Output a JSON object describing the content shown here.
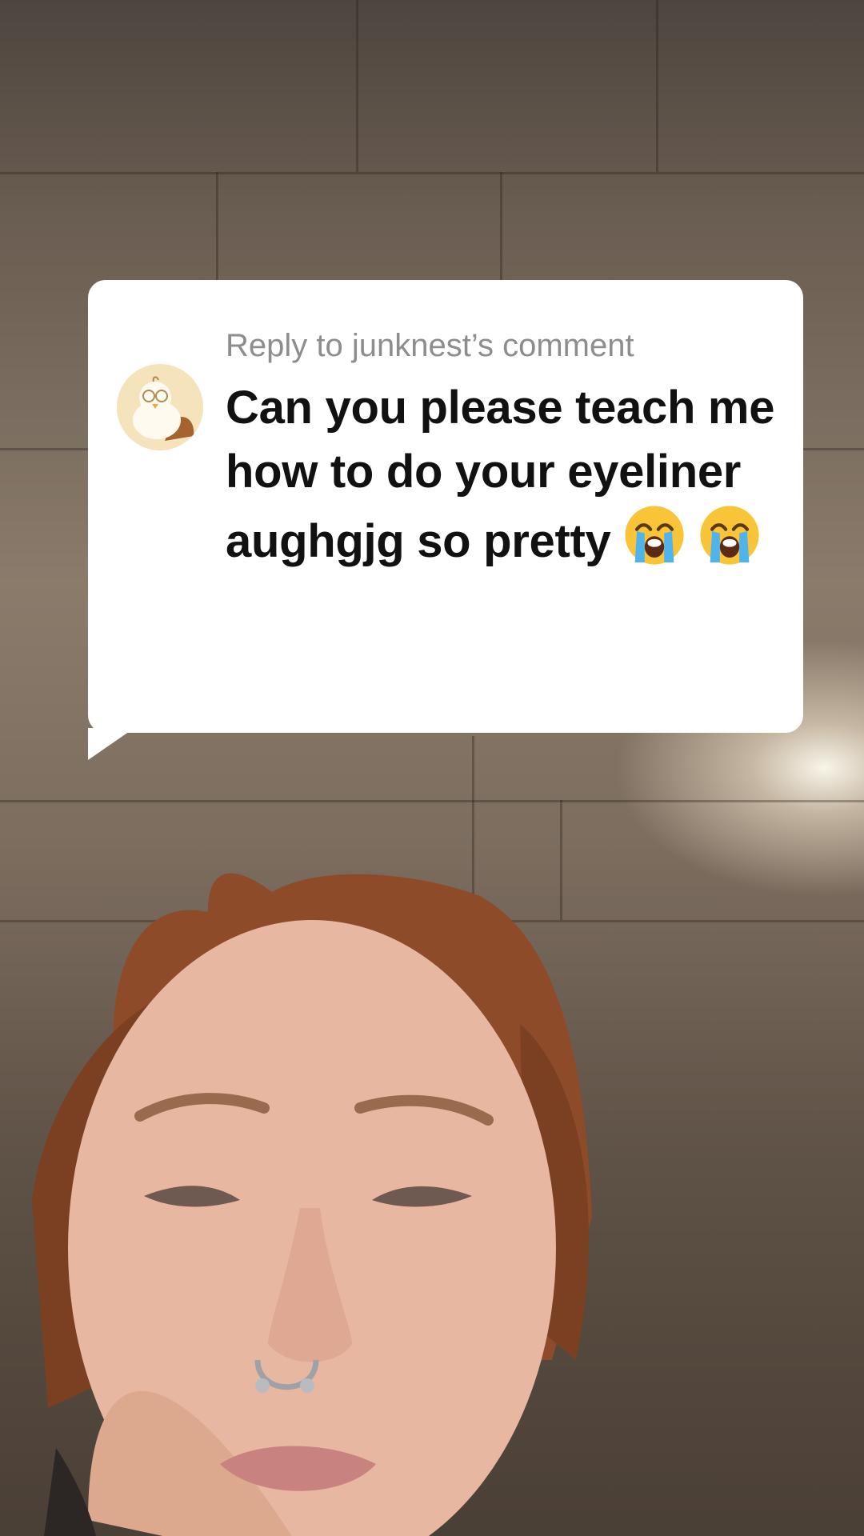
{
  "comment_card": {
    "reply_label": "Reply to junknest’s comment",
    "comment_text": "Can you please teach me how to do your eyeliner aughgjg so pretty",
    "trailing_emoji": [
      "loudly-crying-face-icon",
      "loudly-crying-face-icon"
    ]
  },
  "avatar": {
    "icon": "duck-avatar-icon"
  },
  "colors": {
    "card": "#ffffff",
    "reply_label": "#8d8d8d",
    "comment_text": "#111111"
  }
}
